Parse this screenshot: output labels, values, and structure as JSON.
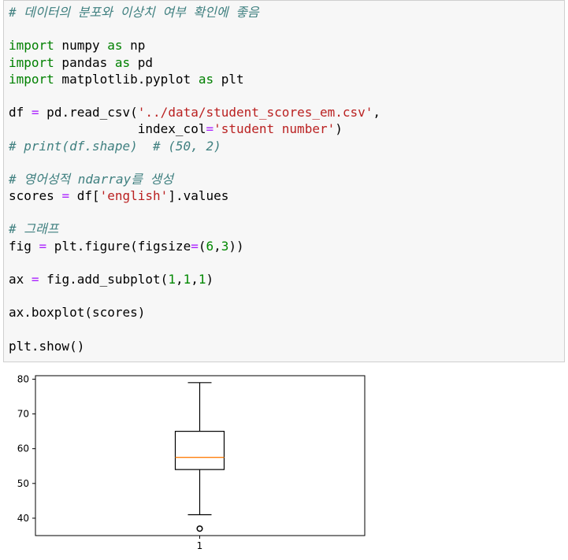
{
  "code_cell": {
    "lines": [
      [
        {
          "t": "# 데이터의 분포와 이상치 여부 확인에 좋음",
          "c": "cm"
        }
      ],
      [],
      [
        {
          "t": "import",
          "c": "kw"
        },
        {
          "t": " numpy ",
          "c": ""
        },
        {
          "t": "as",
          "c": "kw"
        },
        {
          "t": " np",
          "c": ""
        }
      ],
      [
        {
          "t": "import",
          "c": "kw"
        },
        {
          "t": " pandas ",
          "c": ""
        },
        {
          "t": "as",
          "c": "kw"
        },
        {
          "t": " pd",
          "c": ""
        }
      ],
      [
        {
          "t": "import",
          "c": "kw"
        },
        {
          "t": " matplotlib.pyplot ",
          "c": ""
        },
        {
          "t": "as",
          "c": "kw"
        },
        {
          "t": " plt",
          "c": ""
        }
      ],
      [],
      [
        {
          "t": "df ",
          "c": ""
        },
        {
          "t": "=",
          "c": "op"
        },
        {
          "t": " pd.read_csv(",
          "c": ""
        },
        {
          "t": "'../data/student_scores_em.csv'",
          "c": "str"
        },
        {
          "t": ",",
          "c": ""
        }
      ],
      [
        {
          "t": "                 index_col",
          "c": ""
        },
        {
          "t": "=",
          "c": "op"
        },
        {
          "t": "'student number'",
          "c": "str"
        },
        {
          "t": ")",
          "c": ""
        }
      ],
      [
        {
          "t": "# print(df.shape)  # (50, 2)",
          "c": "cm"
        }
      ],
      [],
      [
        {
          "t": "# 영어성적 ndarray를 생성",
          "c": "cm"
        }
      ],
      [
        {
          "t": "scores ",
          "c": ""
        },
        {
          "t": "=",
          "c": "op"
        },
        {
          "t": " df[",
          "c": ""
        },
        {
          "t": "'english'",
          "c": "str"
        },
        {
          "t": "].values",
          "c": ""
        }
      ],
      [],
      [
        {
          "t": "# 그래프",
          "c": "cm"
        }
      ],
      [
        {
          "t": "fig ",
          "c": ""
        },
        {
          "t": "=",
          "c": "op"
        },
        {
          "t": " plt.figure(figsize",
          "c": ""
        },
        {
          "t": "=",
          "c": "op"
        },
        {
          "t": "(",
          "c": ""
        },
        {
          "t": "6",
          "c": "num"
        },
        {
          "t": ",",
          "c": ""
        },
        {
          "t": "3",
          "c": "num"
        },
        {
          "t": "))",
          "c": ""
        }
      ],
      [],
      [
        {
          "t": "ax ",
          "c": ""
        },
        {
          "t": "=",
          "c": "op"
        },
        {
          "t": " fig.add_subplot(",
          "c": ""
        },
        {
          "t": "1",
          "c": "num"
        },
        {
          "t": ",",
          "c": ""
        },
        {
          "t": "1",
          "c": "num"
        },
        {
          "t": ",",
          "c": ""
        },
        {
          "t": "1",
          "c": "num"
        },
        {
          "t": ")",
          "c": ""
        }
      ],
      [],
      [
        {
          "t": "ax.boxplot(scores)",
          "c": ""
        }
      ],
      [],
      [
        {
          "t": "plt.show()",
          "c": ""
        }
      ]
    ]
  },
  "chart_data": {
    "type": "box",
    "categories": [
      "1"
    ],
    "box": {
      "whisker_low": 41,
      "q1": 54,
      "median": 57.5,
      "q3": 65,
      "whisker_high": 79,
      "outliers": [
        37
      ]
    },
    "ylim": [
      35,
      81
    ],
    "yticks": [
      40,
      50,
      60,
      70,
      80
    ],
    "ytick_labels": [
      "40",
      "50",
      "60",
      "70",
      "80"
    ],
    "xtick_labels": [
      "1"
    ],
    "title": "",
    "xlabel": "",
    "ylabel": "",
    "grid": false,
    "colors": {
      "box": "#000000",
      "median": "#ff7f0e",
      "flier": "#000000"
    }
  }
}
